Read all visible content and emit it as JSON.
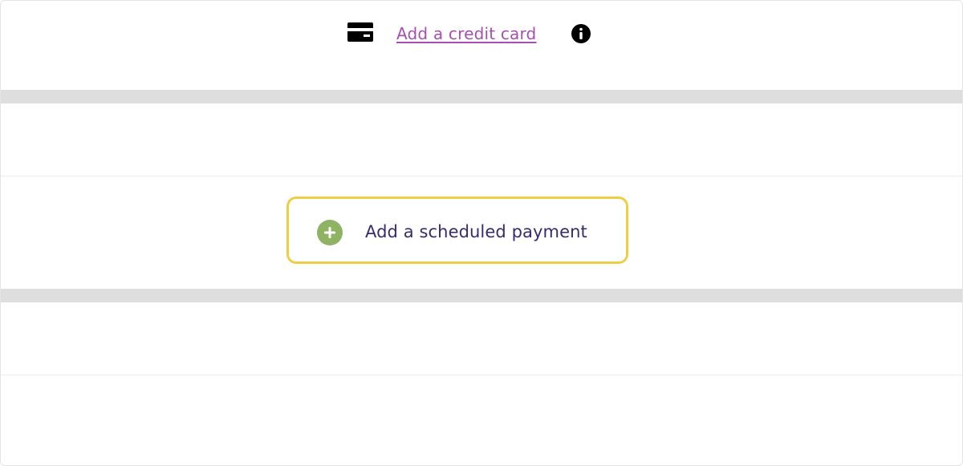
{
  "payment_method": {
    "card_icon": "credit-card-icon",
    "add_card_label": "Add a credit card",
    "info_icon": "info-icon",
    "link_color": "#a64fb0"
  },
  "scheduled_payment": {
    "plus_icon": "plus-circle-icon",
    "label": "Add a scheduled payment",
    "accent_color": "#8db363",
    "border_color": "#f0cd47",
    "text_color": "#3a2a70"
  }
}
